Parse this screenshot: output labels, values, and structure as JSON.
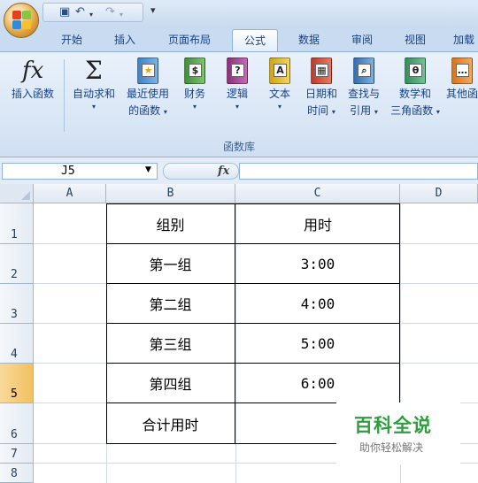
{
  "qat": {
    "save_icon": "save-icon",
    "undo_icon": "undo-icon",
    "redo_icon": "redo-icon"
  },
  "tabs": [
    {
      "label": "开始"
    },
    {
      "label": "插入"
    },
    {
      "label": "页面布局"
    },
    {
      "label": "公式"
    },
    {
      "label": "数据"
    },
    {
      "label": "审阅"
    },
    {
      "label": "视图"
    },
    {
      "label": "加载"
    }
  ],
  "ribbon": {
    "insert_function": "插入函数",
    "autosum": "自动求和",
    "recent_1": "最近使用",
    "recent_2": "的函数",
    "financial": "财务",
    "logical": "逻辑",
    "text": "文本",
    "datetime_1": "日期和",
    "datetime_2": "时间",
    "lookup_1": "查找与",
    "lookup_2": "引用",
    "math_1": "数学和",
    "math_2": "三角函数",
    "other_1": "其他函",
    "group_label": "函数库"
  },
  "formula_bar": {
    "name_box": "J5",
    "fx": "fx",
    "value": ""
  },
  "columns": [
    "A",
    "B",
    "C",
    "D"
  ],
  "rows": [
    "1",
    "2",
    "3",
    "4",
    "5",
    "6",
    "7",
    "8"
  ],
  "selected_row": "5",
  "table": {
    "header": {
      "group": "组别",
      "time": "用时"
    },
    "rows": [
      {
        "group": "第一组",
        "time": "3:00"
      },
      {
        "group": "第二组",
        "time": "4:00"
      },
      {
        "group": "第三组",
        "time": "5:00"
      },
      {
        "group": "第四组",
        "time": "6:00"
      }
    ],
    "total_label": "合计用时",
    "total_value": ""
  },
  "watermark": {
    "title": "百科全说",
    "subtitle": "助你轻松解决"
  },
  "colors": {
    "accent_green": "#2e9e3e",
    "selected_row": "#f1c15f",
    "ribbon": "#dbe7f6"
  }
}
